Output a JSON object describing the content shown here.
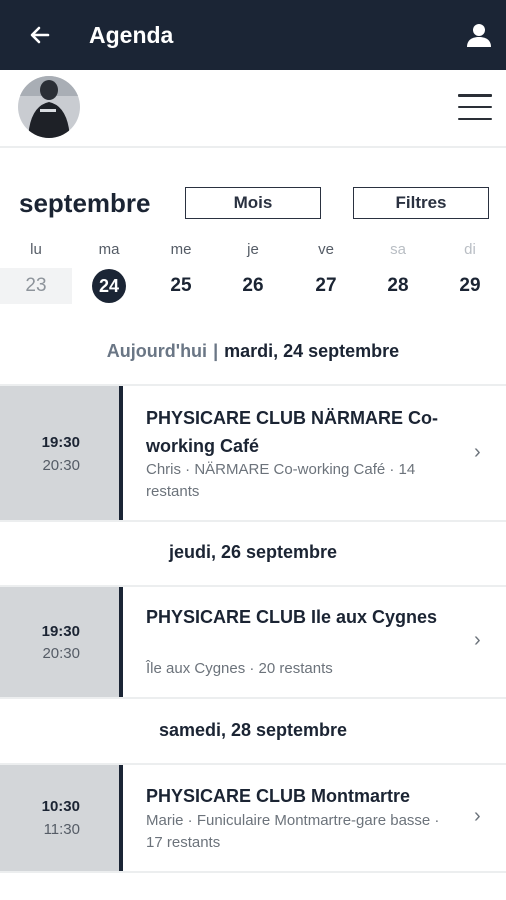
{
  "header": {
    "title": "Agenda",
    "back_icon": "arrow-left-icon",
    "user_icon": "user-icon",
    "bg_color": "#1b2535"
  },
  "subheader": {
    "avatar_icon": "avatar",
    "menu_icon": "hamburger-menu-icon"
  },
  "calendar": {
    "month": "septembre",
    "view_button": "Mois",
    "filter_button": "Filtres",
    "weekdays": [
      "lu",
      "ma",
      "me",
      "je",
      "ve",
      "sa",
      "di"
    ],
    "days": [
      "23",
      "24",
      "25",
      "26",
      "27",
      "28",
      "29"
    ],
    "selected_day": "24"
  },
  "agenda": {
    "today_label": "Aujourd'hui",
    "separator": "|",
    "groups": [
      {
        "date": "mardi, 24 septembre",
        "event": {
          "start": "19:30",
          "end": "20:30",
          "title": "PHYSICARE CLUB NÄRMARE Co-working Café",
          "details": "Chris · NÄRMARE Co-working Café · 14 restants"
        }
      },
      {
        "date": "jeudi, 26 septembre",
        "event": {
          "start": "19:30",
          "end": "20:30",
          "title": "PHYSICARE CLUB Ile aux Cygnes",
          "details": "Île aux Cygnes · 20 restants"
        }
      },
      {
        "date": "samedi, 28 septembre",
        "event": {
          "start": "10:30",
          "end": "11:30",
          "title": "PHYSICARE CLUB Montmartre",
          "details": "Marie · Funiculaire Montmartre-gare basse · 17 restants"
        }
      }
    ],
    "chevron": "›"
  }
}
